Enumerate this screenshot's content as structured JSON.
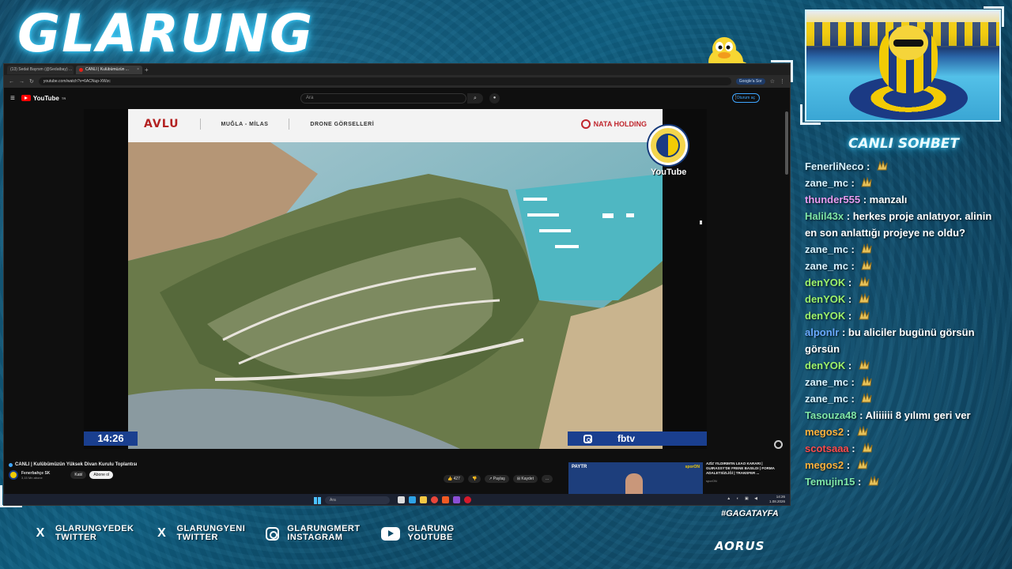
{
  "brand": {
    "title": "GLARUNG"
  },
  "browser": {
    "tabs": [
      {
        "label": "(13) Sedat Bayrsm (@Sedatbay) ..."
      },
      {
        "label": "CANLI | Kulübümüzün ..."
      }
    ],
    "new_tab": "+",
    "url": "youtube.com/watch?v=6ACNup-XWzc",
    "google_search": "Google'a Sor"
  },
  "youtube": {
    "logo_text": "YouTube",
    "logo_sup": "TR",
    "search_placeholder": "Ara",
    "sign_in": "Oturum aç",
    "slide": {
      "brand": "AVLU",
      "location": "MUĞLA - MİLAS",
      "section": "DRONE GÖRSELLERİ",
      "company": "NATA HOLDING"
    },
    "overlay": {
      "clock": "14:26",
      "fbtv": "fbtv",
      "badge_label": "YouTube"
    },
    "video_title": "CANLI | Kulübümüzün Yüksek Divan Kurulu Toplantısı",
    "channel_name": "Fenerbahçe SK",
    "channel_subs": "3,15 Mn abone",
    "join": "Katıl",
    "subscribe": "Abone ol",
    "likes": "427",
    "share": "Paylaş",
    "save": "Kaydet",
    "more": "...",
    "side_video": {
      "tag": "PAYTR",
      "network": "sporON",
      "title": "AZİZ YILDIRIM'IN LEAO KARARI | GUIRASSY'DE FRENE BASILDI | FORMA ADALETSİZLİĞİ | TRANSFER ...",
      "meta": "sporON"
    }
  },
  "taskbar": {
    "search": "Ara",
    "time": "14:26",
    "date": "1.08.2026"
  },
  "chat": {
    "title": "CANLI SOHBET",
    "messages": [
      {
        "user": "FenerliNeco",
        "color": "#d7f2ff",
        "text": "",
        "emote": true
      },
      {
        "user": "zane_mc",
        "color": "#d7f2ff",
        "text": "",
        "emote": true
      },
      {
        "user": "thunder555",
        "color": "#e89cf0",
        "text": "manzalı",
        "emote": false
      },
      {
        "user": "Halil43x",
        "color": "#7fe6a6",
        "text": "herkes proje anlatıyor. alinin en son anlattığı projeye ne oldu?",
        "emote": false
      },
      {
        "user": "zane_mc",
        "color": "#d7f2ff",
        "text": "",
        "emote": true
      },
      {
        "user": "zane_mc",
        "color": "#d7f2ff",
        "text": "",
        "emote": true
      },
      {
        "user": "denYOK",
        "color": "#9ef26b",
        "text": "",
        "emote": true
      },
      {
        "user": "denYOK",
        "color": "#9ef26b",
        "text": "",
        "emote": true
      },
      {
        "user": "denYOK",
        "color": "#9ef26b",
        "text": "",
        "emote": true
      },
      {
        "user": "alponlr",
        "color": "#6aa9ff",
        "text": "bu aliciler bugünü görsün görsün",
        "emote": false
      },
      {
        "user": "denYOK",
        "color": "#9ef26b",
        "text": "",
        "emote": true
      },
      {
        "user": "zane_mc",
        "color": "#d7f2ff",
        "text": "",
        "emote": true
      },
      {
        "user": "zane_mc",
        "color": "#d7f2ff",
        "text": "",
        "emote": true
      },
      {
        "user": "Tasouza48",
        "color": "#7fe6a6",
        "text": "Aliiiiii 8 yılımı geri ver",
        "emote": false
      },
      {
        "user": "megos2",
        "color": "#ffb13b",
        "text": "",
        "emote": true
      },
      {
        "user": "scotsaaa",
        "color": "#ff4a4a",
        "text": "",
        "emote": true
      },
      {
        "user": "megos2",
        "color": "#ffb13b",
        "text": "",
        "emote": true
      },
      {
        "user": "Temujin15",
        "color": "#7fe6a6",
        "text": "",
        "emote": true
      }
    ]
  },
  "socials": [
    {
      "icon": "x-icon",
      "line1": "GLARUNGYEDEK",
      "line2": "TWITTER"
    },
    {
      "icon": "x-icon",
      "line1": "GLARUNGYENI",
      "line2": "TWITTER"
    },
    {
      "icon": "instagram-icon",
      "line1": "GLARUNGMERT",
      "line2": "INSTAGRAM"
    },
    {
      "icon": "youtube-icon",
      "line1": "GLARUNG",
      "line2": "YOUTUBE"
    }
  ],
  "hashtag": "#GAGATAYFA",
  "sponsor": "AORUS",
  "colors": {
    "accent_blue": "#1a3f8f",
    "fb_yellow": "#f2cb05",
    "fb_navy": "#1b3a84",
    "neon": "#4fd8ff"
  }
}
